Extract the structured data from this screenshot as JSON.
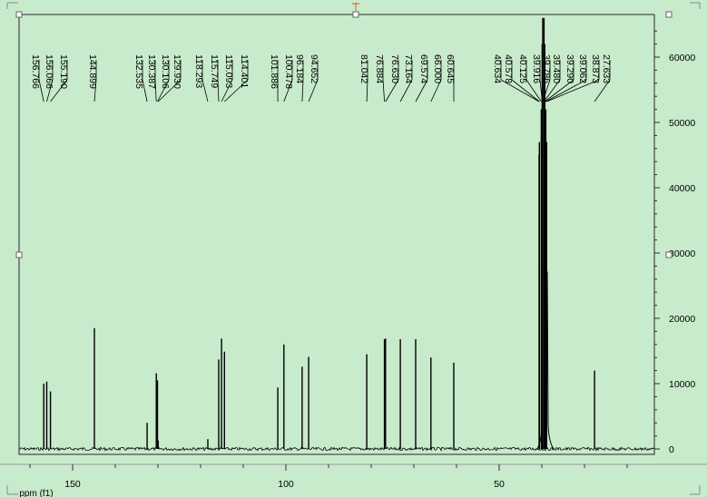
{
  "chart_data": {
    "type": "line",
    "x_axis": {
      "label": "ppm (f1)",
      "reversed": true,
      "range": [
        210,
        10
      ],
      "ticks": [
        150,
        100,
        50
      ]
    },
    "y_axis": {
      "range": [
        -1500,
        66000
      ],
      "ticks": [
        0,
        10000,
        20000,
        30000,
        40000,
        50000,
        60000
      ]
    },
    "grid": false,
    "baseline": 0,
    "peaks": [
      {
        "ppm": 156.766,
        "label": "156.766",
        "height": 10000
      },
      {
        "ppm": 156.066,
        "label": "156.066",
        "height": 10300
      },
      {
        "ppm": 155.19,
        "label": "155.190",
        "height": 8800
      },
      {
        "ppm": 144.899,
        "label": "144.899",
        "height": 18500
      },
      {
        "ppm": 132.535,
        "label": "132.535",
        "height": 4000
      },
      {
        "ppm": 130.387,
        "label": "130.387",
        "height": 11600
      },
      {
        "ppm": 130.106,
        "label": "130.106",
        "height": 10500
      },
      {
        "ppm": 129.93,
        "label": "129.930",
        "height": 1300
      },
      {
        "ppm": 118.293,
        "label": "118.293",
        "height": 1500
      },
      {
        "ppm": 115.749,
        "label": "115.749",
        "height": 13700
      },
      {
        "ppm": 115.093,
        "label": "115.093",
        "height": 16900
      },
      {
        "ppm": 114.401,
        "label": "114.401",
        "height": 14900
      },
      {
        "ppm": 101.886,
        "label": "101.886",
        "height": 9400
      },
      {
        "ppm": 100.478,
        "label": "100.478",
        "height": 16000
      },
      {
        "ppm": 96.184,
        "label": "96.184",
        "height": 12600
      },
      {
        "ppm": 94.652,
        "label": "94.652",
        "height": 14100
      },
      {
        "ppm": 81.042,
        "label": "81.042",
        "height": 14500
      },
      {
        "ppm": 76.884,
        "label": "76.884",
        "height": 16800
      },
      {
        "ppm": 76.63,
        "label": "76.630",
        "height": 16900
      },
      {
        "ppm": 73.164,
        "label": "73.164",
        "height": 16800
      },
      {
        "ppm": 69.574,
        "label": "69.574",
        "height": 16800
      },
      {
        "ppm": 66.0,
        "label": "66.000",
        "height": 14000
      },
      {
        "ppm": 60.645,
        "label": "60.645",
        "height": 13200
      },
      {
        "ppm": 40.634,
        "label": "40.634",
        "height": 45000
      },
      {
        "ppm": 40.578,
        "label": "40.578",
        "height": 47000
      },
      {
        "ppm": 40.125,
        "label": "40.125",
        "height": 52000
      },
      {
        "ppm": 39.916,
        "label": "39.916",
        "height": 62000
      },
      {
        "ppm": 39.786,
        "label": "39.786",
        "height": 66000
      },
      {
        "ppm": 39.48,
        "label": "39.480",
        "height": 66000
      },
      {
        "ppm": 39.29,
        "label": "39.290",
        "height": 62000
      },
      {
        "ppm": 39.062,
        "label": "39.062",
        "height": 52000
      },
      {
        "ppm": 38.873,
        "label": "38.873",
        "height": 47000
      },
      {
        "ppm": 27.633,
        "label": "27.633",
        "height": 12000
      }
    ],
    "y_tick_labels": [
      "0",
      "10000",
      "20000",
      "30000",
      "40000",
      "50000",
      "60000"
    ],
    "x_tick_labels": [
      "150",
      "100",
      "50"
    ]
  },
  "colors": {
    "background": "#c8ebcb",
    "trace": "#000000",
    "frame": "#2a2a2a",
    "selection_handle": "#666666",
    "top_handle": "#e05a2a"
  }
}
